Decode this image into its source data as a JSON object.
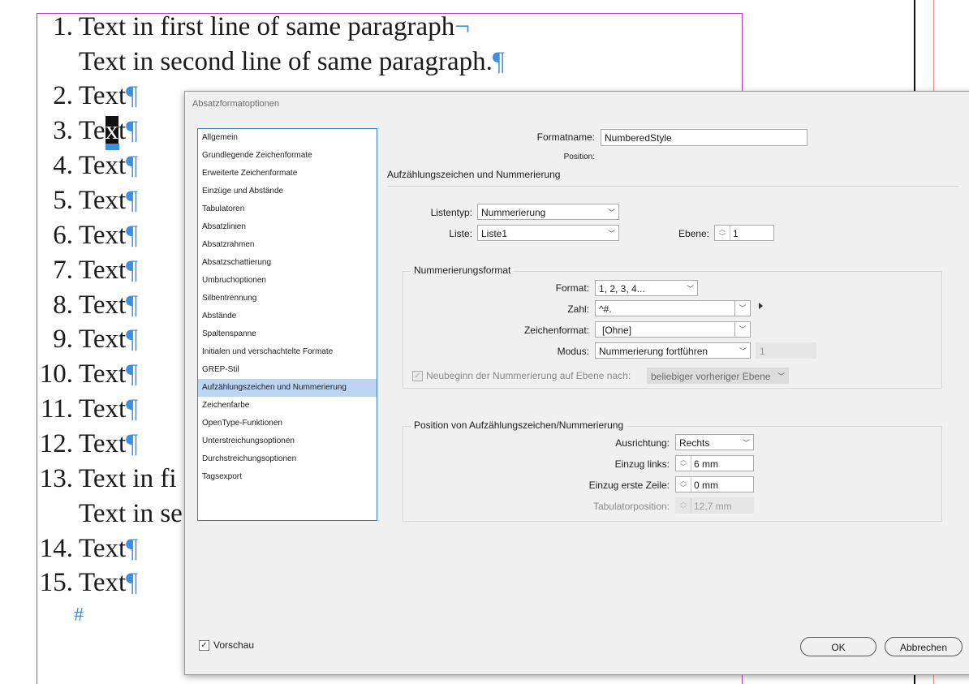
{
  "document": {
    "lines": [
      {
        "num": "1.",
        "text": "Text in first line of same paragraph",
        "mark": "¬"
      },
      {
        "num": "",
        "text": "Text in second line of same paragraph.",
        "mark": "¶"
      },
      {
        "num": "2.",
        "text": "Text",
        "mark": "¶"
      },
      {
        "num": "3.",
        "text_before": "Te",
        "text_sel": "x",
        "text_after": "t",
        "mark": "¶"
      },
      {
        "num": "4.",
        "text": "Text",
        "mark": "¶"
      },
      {
        "num": "5.",
        "text": "Text",
        "mark": "¶"
      },
      {
        "num": "6.",
        "text": "Text",
        "mark": "¶"
      },
      {
        "num": "7.",
        "text": "Text",
        "mark": "¶"
      },
      {
        "num": "8.",
        "text": "Text",
        "mark": "¶"
      },
      {
        "num": "9.",
        "text": "Text",
        "mark": "¶"
      },
      {
        "num": "10.",
        "text": "Text",
        "mark": "¶"
      },
      {
        "num": "11.",
        "text": "Text",
        "mark": "¶"
      },
      {
        "num": "12.",
        "text": "Text",
        "mark": "¶"
      },
      {
        "num": "13.",
        "text": "Text in fi",
        "mark": ""
      },
      {
        "num": "",
        "text": "Text in se",
        "mark": ""
      },
      {
        "num": "14.",
        "text": "Text",
        "mark": "¶"
      },
      {
        "num": "15.",
        "text": "Text",
        "mark": "¶"
      }
    ],
    "end_marker": "#"
  },
  "dialog": {
    "title": "Absatzformatoptionen",
    "categories": [
      "Allgemein",
      "Grundlegende Zeichenformate",
      "Erweiterte Zeichenformate",
      "Einzüge und Abstände",
      "Tabulatoren",
      "Absatzlinien",
      "Absatzrahmen",
      "Absatzschattierung",
      "Umbruchoptionen",
      "Silbentrennung",
      "Abstände",
      "Spaltenspanne",
      "Initialen und verschachtelte Formate",
      "GREP-Stil",
      "Aufzählungszeichen und Nummerierung",
      "Zeichenfarbe",
      "OpenType-Funktionen",
      "Unterstreichungsoptionen",
      "Durchstreichungsoptionen",
      "Tagsexport"
    ],
    "selected_category": "Aufzählungszeichen und Nummerierung",
    "formatname_label": "Formatname:",
    "formatname_value": "NumberedStyle",
    "position_label": "Position:",
    "section_title": "Aufzählungszeichen und Nummerierung",
    "listentyp_label": "Listentyp:",
    "listentyp_value": "Nummerierung",
    "liste_label": "Liste:",
    "liste_value": "Liste1",
    "ebene_label": "Ebene:",
    "ebene_value": "1",
    "numfmt_group": "Nummerierungsformat",
    "format_label": "Format:",
    "format_value": "1, 2, 3, 4...",
    "zahl_label": "Zahl:",
    "zahl_value": "^#.",
    "zeichenformat_label": "Zeichenformat:",
    "zeichenformat_value": "[Ohne]",
    "modus_label": "Modus:",
    "modus_value": "Nummerierung fortführen",
    "modus_start": "1",
    "neubeginn_label": "Neubeginn der Nummerierung auf Ebene nach:",
    "neubeginn_value": "beliebiger vorheriger Ebene",
    "pos_group": "Position von Aufzählungszeichen/Nummerierung",
    "ausrichtung_label": "Ausrichtung:",
    "ausrichtung_value": "Rechts",
    "einzug_links_label": "Einzug links:",
    "einzug_links_value": "6 mm",
    "einzug_erste_label": "Einzug erste Zeile:",
    "einzug_erste_value": "0 mm",
    "tabpos_label": "Tabulatorposition:",
    "tabpos_value": "12,7 mm",
    "vorschau_label": "Vorschau",
    "ok_label": "OK",
    "abbrechen_label": "Abbrechen"
  }
}
